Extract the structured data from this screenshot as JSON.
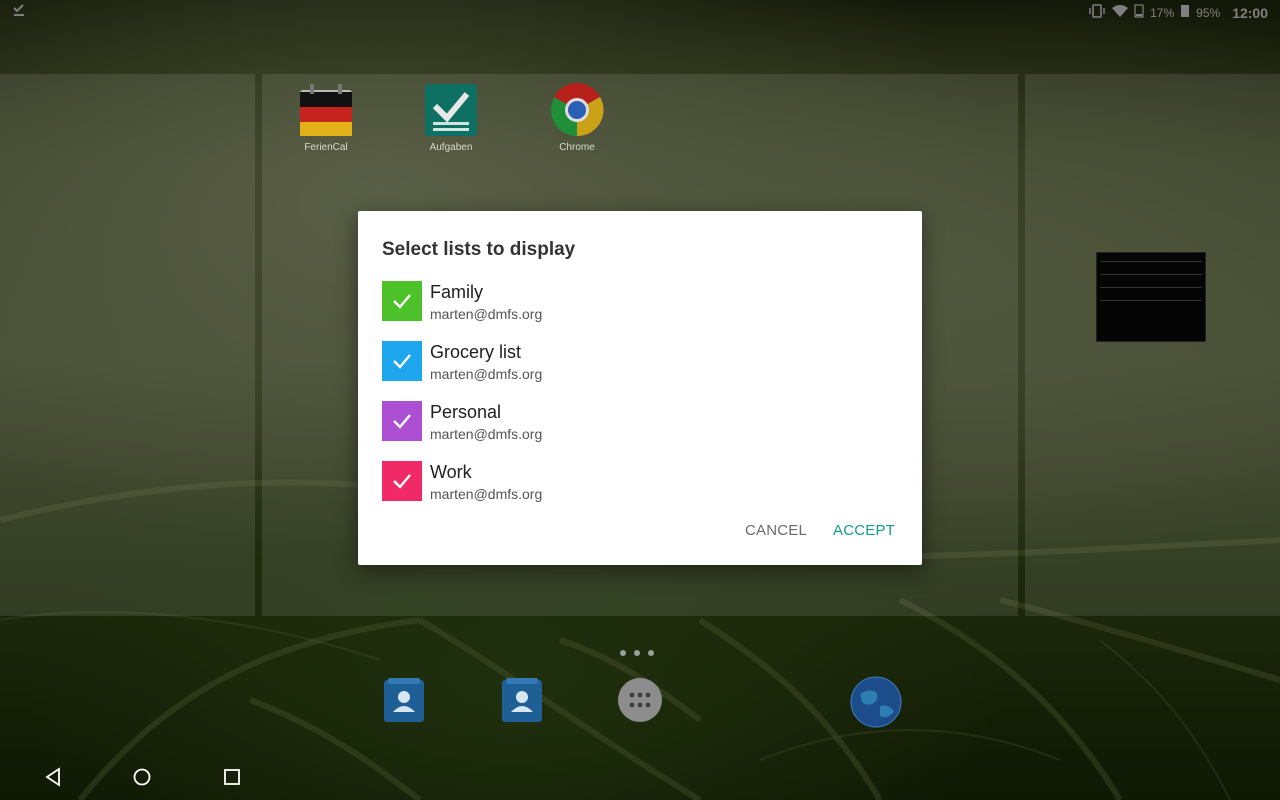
{
  "status_bar": {
    "notification_icon": "task-checkbox-icon",
    "vibrate_icon": "vibrate-icon",
    "wifi_icon": "wifi-icon",
    "signal_percent": "17%",
    "battery_percent": "95%",
    "time": "12:00"
  },
  "home_apps": [
    {
      "label": "FerienCal",
      "icon": "german-flag-calendar-icon"
    },
    {
      "label": "Aufgaben",
      "icon": "tasks-check-icon"
    },
    {
      "label": "Chrome",
      "icon": "chrome-icon"
    }
  ],
  "dialog": {
    "title": "Select lists to display",
    "items": [
      {
        "name": "Family",
        "account": "marten@dmfs.org",
        "color": "#4cc12a",
        "checked": true
      },
      {
        "name": "Grocery list",
        "account": "marten@dmfs.org",
        "color": "#1ea6ee",
        "checked": true
      },
      {
        "name": "Personal",
        "account": "marten@dmfs.org",
        "color": "#ad4fd2",
        "checked": true
      },
      {
        "name": "Work",
        "account": "marten@dmfs.org",
        "color": "#f12a67",
        "checked": true
      }
    ],
    "cancel_label": "CANCEL",
    "accept_label": "ACCEPT",
    "accent_color": "#119b8e"
  },
  "dock": {
    "items": [
      "contacts-icon",
      "contacts-icon",
      "app-drawer-icon",
      "globe-icon"
    ]
  },
  "nav_bar": {
    "items": [
      "back-icon",
      "home-icon",
      "recents-icon"
    ]
  }
}
